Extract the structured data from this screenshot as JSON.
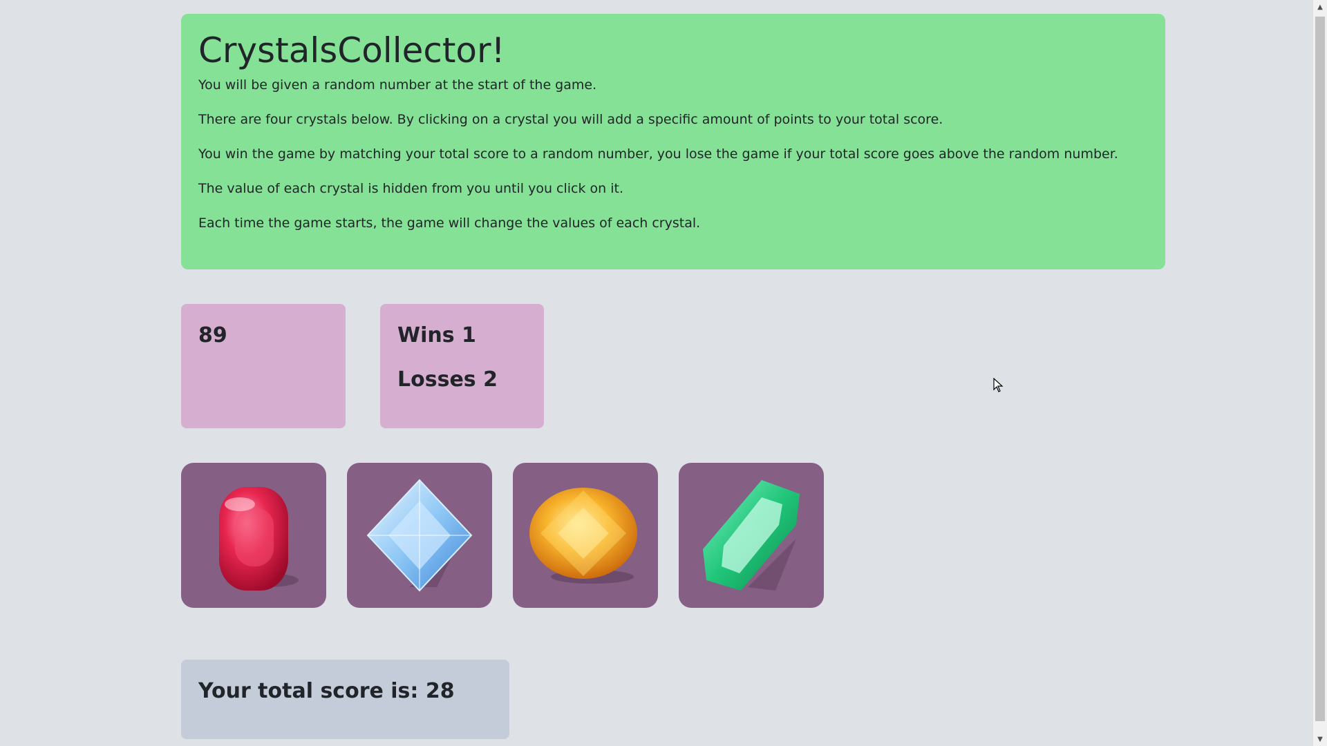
{
  "header": {
    "title": "CrystalsCollector!",
    "instructions": [
      "You will be given a random number at the start of the game.",
      "There are four crystals below. By clicking on a crystal you will add a specific amount of points to your total score.",
      "You win the game by matching your total score to a random number, you lose the game if your total score goes above the random number.",
      "The value of each crystal is hidden from you until you click on it.",
      "Each time the game starts, the game will change the values of each crystal."
    ]
  },
  "target": {
    "number": "89"
  },
  "record": {
    "wins_label": "Wins 1",
    "losses_label": "Losses 2"
  },
  "crystals": [
    {
      "name": "red-ruby-crystal",
      "icon": "ruby-icon",
      "color": "#d81b45"
    },
    {
      "name": "blue-diamond-crystal",
      "icon": "diamond-icon",
      "color": "#7fb8f0"
    },
    {
      "name": "orange-topaz-crystal",
      "icon": "topaz-icon",
      "color": "#f5a623"
    },
    {
      "name": "green-emerald-crystal",
      "icon": "emerald-icon",
      "color": "#1fbf72"
    }
  ],
  "score": {
    "label": "Your total score is: 28"
  },
  "colors": {
    "jumbotron": "#84e196",
    "stat_box": "#d6aed0",
    "crystal_tile": "#865f85",
    "score_box": "#c4cbd9",
    "background": "#dee2e6"
  }
}
